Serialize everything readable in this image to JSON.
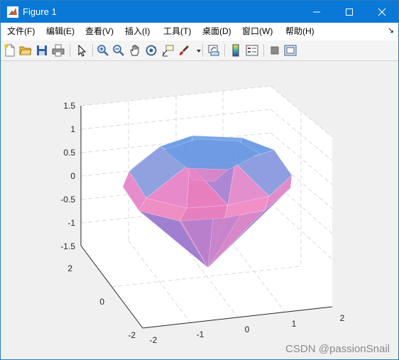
{
  "window": {
    "title": "Figure 1"
  },
  "menubar": {
    "items": [
      "文件(F)",
      "编辑(E)",
      "查看(V)",
      "插入(I)",
      "工具(T)",
      "桌面(D)",
      "窗口(W)",
      "帮助(H)"
    ]
  },
  "toolbar": {
    "buttons": [
      "new-figure",
      "open-file",
      "save",
      "print",
      "edit-plot",
      "zoom-in",
      "zoom-out",
      "pan",
      "rotate-3d",
      "data-cursor",
      "brush",
      "link-plot",
      "colorbar",
      "legend",
      "hide-plot-tools",
      "show-plot-tools"
    ]
  },
  "chart_data": {
    "type": "3d-surface",
    "z_ticks": [
      "1.5",
      "1",
      "0.5",
      "0",
      "-0.5",
      "-1",
      "-1.5"
    ],
    "y_ticks": [
      "2",
      "0",
      "-2"
    ],
    "x_ticks": [
      "-2",
      "-1",
      "0",
      "1",
      "2"
    ],
    "zlim": [
      -1.5,
      1.5
    ],
    "ylim": [
      -2,
      2
    ],
    "xlim": [
      -2,
      2
    ],
    "grid": true,
    "colors": {
      "pink": "#e77fbf",
      "blue": "#6f9fe4",
      "purple": "#9181d6"
    }
  },
  "watermark": "CSDN @passionSnail"
}
